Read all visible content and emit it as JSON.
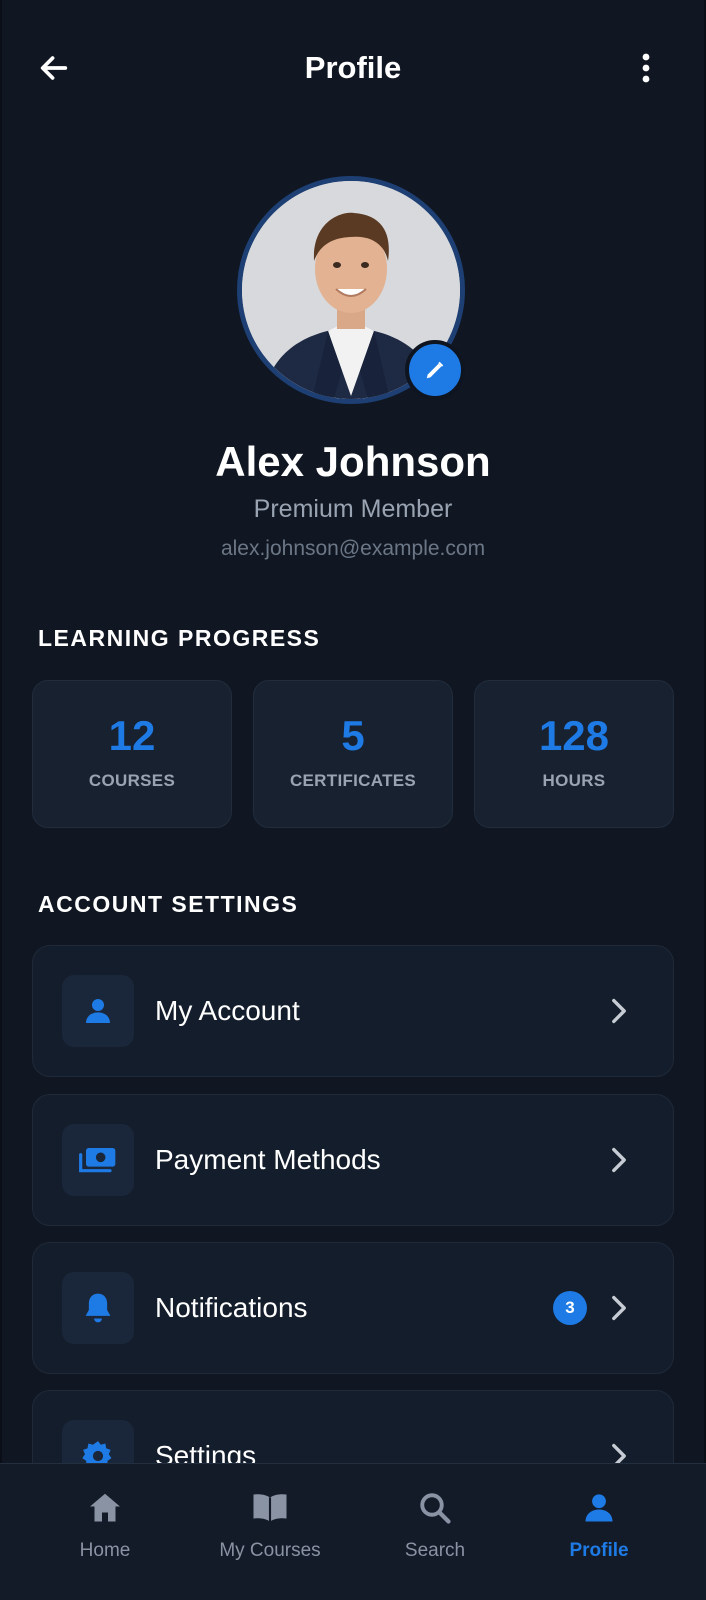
{
  "header": {
    "title": "Profile",
    "back_icon": "arrow-left-icon",
    "menu_icon": "more-vertical-icon"
  },
  "profile": {
    "name": "Alex Johnson",
    "tier": "Premium Member",
    "email": "alex.johnson@example.com",
    "edit_icon": "pencil-icon"
  },
  "learning_progress": {
    "title": "LEARNING PROGRESS",
    "stats": [
      {
        "value": "12",
        "label": "COURSES"
      },
      {
        "value": "5",
        "label": "CERTIFICATES"
      },
      {
        "value": "128",
        "label": "HOURS"
      }
    ]
  },
  "account_settings": {
    "title": "ACCOUNT SETTINGS",
    "items": [
      {
        "label": "My Account",
        "icon": "user-icon"
      },
      {
        "label": "Payment Methods",
        "icon": "money-icon"
      },
      {
        "label": "Notifications",
        "icon": "bell-icon",
        "badge": "3"
      },
      {
        "label": "Settings",
        "icon": "gear-icon"
      }
    ]
  },
  "bottom_nav": {
    "items": [
      {
        "label": "Home",
        "icon": "home-icon",
        "active": false
      },
      {
        "label": "My Courses",
        "icon": "book-icon",
        "active": false
      },
      {
        "label": "Search",
        "icon": "search-icon",
        "active": false
      },
      {
        "label": "Profile",
        "icon": "user-icon",
        "active": true
      }
    ]
  },
  "colors": {
    "background": "#101722",
    "accent": "#1e7ae5",
    "card": "#172130",
    "muted_text": "#9aa3b2"
  }
}
